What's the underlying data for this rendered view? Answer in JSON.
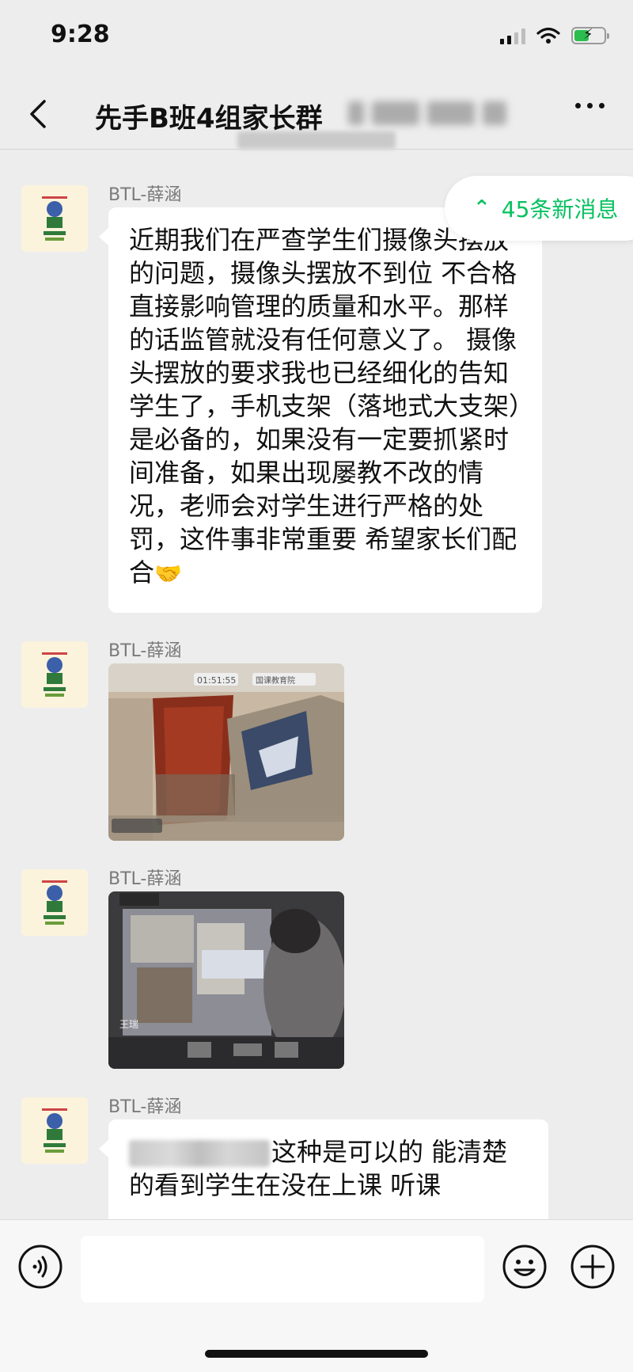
{
  "status": {
    "time": "9:28"
  },
  "nav": {
    "title": "先手B班4组家长群"
  },
  "new_messages": {
    "label": "45条新消息"
  },
  "messages": [
    {
      "sender": "BTL-薛涵",
      "text": "近期我们在严查学生们摄像头摆放的问题，摄像头摆放不到位 不合格 直接影响管理的质量和水平。那样的话监管就没有任何意义了。    摄像头摆放的要求我也已经细化的告知学生了，手机支架（落地式大支架）是必备的，如果没有一定要抓紧时间准备，如果出现屡教不改的情况，老师会对学生进行严格的处罚，这件事非常重要 希望家长们配合",
      "emoji": "🤝"
    },
    {
      "sender": "BTL-薛涵",
      "image": {
        "timer": "01:51:55",
        "app_badge": "国课教育院"
      }
    },
    {
      "sender": "BTL-薛涵",
      "image": {
        "name_tag": "王瑞"
      }
    },
    {
      "sender": "BTL-薛涵",
      "text": "这种是可以的 能清楚的看到学生在没在上课 听课"
    }
  ],
  "input": {
    "placeholder": ""
  },
  "icons": {
    "back": "chevron-left-icon",
    "more": "more-dots-icon",
    "new_messages": "double-chevron-up-icon",
    "voice": "voice-icon",
    "emoji": "emoji-face-icon",
    "add": "plus-circle-icon"
  },
  "colors": {
    "accent": "#07c160",
    "background": "#ededed",
    "bubble": "#ffffff"
  }
}
